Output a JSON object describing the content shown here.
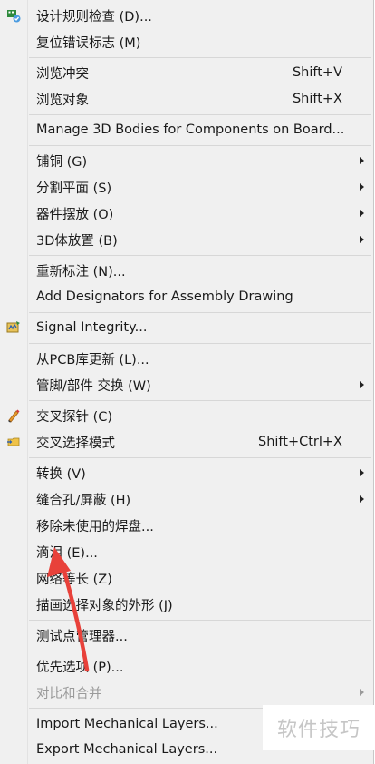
{
  "menu": {
    "items": [
      {
        "label": "设计规则检查 (D)...",
        "shortcut": "",
        "submenu": false,
        "icon": "drc-check-icon"
      },
      {
        "label": "复位错误标志 (M)",
        "shortcut": "",
        "submenu": false
      },
      {
        "label": "浏览冲突",
        "shortcut": "Shift+V",
        "submenu": false
      },
      {
        "label": "浏览对象",
        "shortcut": "Shift+X",
        "submenu": false
      },
      {
        "label": "Manage 3D Bodies for Components on Board...",
        "shortcut": "",
        "submenu": false
      },
      {
        "label": "铺铜 (G)",
        "shortcut": "",
        "submenu": true
      },
      {
        "label": "分割平面 (S)",
        "shortcut": "",
        "submenu": true
      },
      {
        "label": "器件摆放 (O)",
        "shortcut": "",
        "submenu": true
      },
      {
        "label": "3D体放置 (B)",
        "shortcut": "",
        "submenu": true
      },
      {
        "label": "重新标注 (N)...",
        "shortcut": "",
        "submenu": false
      },
      {
        "label": "Add Designators for Assembly Drawing",
        "shortcut": "",
        "submenu": false
      },
      {
        "label": "Signal Integrity...",
        "shortcut": "",
        "submenu": false,
        "icon": "signal-integrity-icon"
      },
      {
        "label": "从PCB库更新 (L)...",
        "shortcut": "",
        "submenu": false
      },
      {
        "label": "管脚/部件 交换 (W)",
        "shortcut": "",
        "submenu": true
      },
      {
        "label": "交叉探针 (C)",
        "shortcut": "",
        "submenu": false,
        "icon": "cross-probe-icon"
      },
      {
        "label": "交叉选择模式",
        "shortcut": "Shift+Ctrl+X",
        "submenu": false,
        "icon": "cross-select-icon"
      },
      {
        "label": "转换 (V)",
        "shortcut": "",
        "submenu": true
      },
      {
        "label": "缝合孔/屏蔽 (H)",
        "shortcut": "",
        "submenu": true
      },
      {
        "label": "移除未使用的焊盘...",
        "shortcut": "",
        "submenu": false
      },
      {
        "label": "滴泪 (E)...",
        "shortcut": "",
        "submenu": false
      },
      {
        "label": "网络等长 (Z)",
        "shortcut": "",
        "submenu": false
      },
      {
        "label": "描画选择对象的外形 (J)",
        "shortcut": "",
        "submenu": false
      },
      {
        "label": "测试点管理器...",
        "shortcut": "",
        "submenu": false
      },
      {
        "label": "优先选项 (P)...",
        "shortcut": "",
        "submenu": false
      },
      {
        "label": "对比和合并",
        "shortcut": "",
        "submenu": true,
        "disabled": true
      },
      {
        "label": "Import Mechanical Layers...",
        "shortcut": "",
        "submenu": false
      },
      {
        "label": "Export Mechanical Layers...",
        "shortcut": "",
        "submenu": false
      }
    ]
  },
  "watermark": "软件技巧",
  "annotation": {
    "type": "arrow",
    "color": "#e8413a",
    "points_to": "滴泪 (E)..."
  }
}
